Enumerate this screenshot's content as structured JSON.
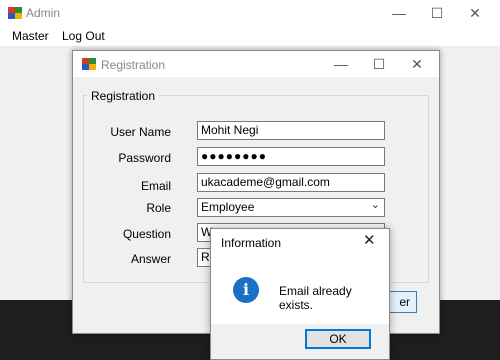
{
  "main_window": {
    "title": "Admin",
    "controls": {
      "minimize": "—",
      "maximize": "☐",
      "close": "✕"
    },
    "menu": [
      "Master",
      "Log Out"
    ]
  },
  "registration_window": {
    "title": "Registration",
    "group_caption": "Registration",
    "controls": {
      "minimize": "—",
      "maximize": "☐",
      "close": "✕"
    },
    "fields": {
      "user_name": {
        "label": "User Name",
        "value": "Mohit Negi"
      },
      "password": {
        "label": "Password",
        "value": "●●●●●●●●"
      },
      "email": {
        "label": "Email",
        "value": "ukacademe@gmail.com"
      },
      "role": {
        "label": "Role",
        "value": "Employee"
      },
      "question": {
        "label": "Question",
        "value": "W"
      },
      "answer": {
        "label": "Answer",
        "value": "Ro"
      }
    },
    "submit_partial_label": "er"
  },
  "message_box": {
    "title": "Information",
    "close": "✕",
    "icon": "info-icon",
    "icon_glyph": "i",
    "message": "Email already exists.",
    "ok_label": "OK"
  },
  "colors": {
    "info_blue": "#1b6fc4",
    "focus_blue": "#0078d7",
    "taskbar": "#1e1e1e"
  }
}
